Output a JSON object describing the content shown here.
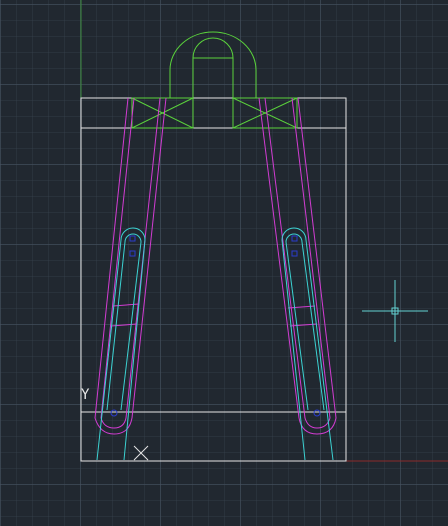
{
  "app": {
    "type": "cad-model-space-viewport"
  },
  "ucs": {
    "y_label": "Y",
    "origin_marker": "X"
  },
  "colors": {
    "background": "#212830",
    "outline": "#e6e6e6",
    "strap": "#d23cd2",
    "slot": "#3cd2d2",
    "handle": "#5ad23c",
    "point": "#2a3ccc",
    "cursor": "#64d2d2",
    "axis_x": "#8a2a2a",
    "axis_y": "#3c8a3c"
  },
  "icons": [
    "crosshair-cursor-icon",
    "ucs-icon"
  ]
}
